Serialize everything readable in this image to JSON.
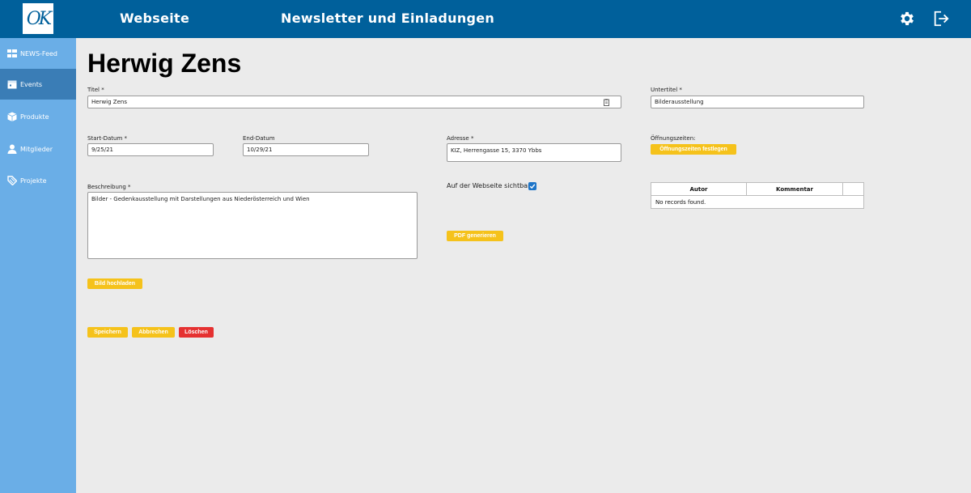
{
  "header": {
    "logo_text": "OK",
    "nav": [
      "Webseite",
      "Newsletter und Einladungen"
    ],
    "settings_icon": "gear-icon",
    "logout_icon": "logout-icon"
  },
  "sidebar": {
    "items": [
      {
        "label": "NEWS-Feed",
        "icon": "grid-icon"
      },
      {
        "label": "Events",
        "icon": "calendar-icon"
      },
      {
        "label": "Produkte",
        "icon": "box-icon"
      },
      {
        "label": "Mitglieder",
        "icon": "user-icon"
      },
      {
        "label": "Projekte",
        "icon": "tag-icon"
      }
    ],
    "active": "Events"
  },
  "page": {
    "title": "Herwig Zens"
  },
  "form": {
    "titel_label": "Titel *",
    "titel_value": "Herwig Zens",
    "untertitel_label": "Untertitel *",
    "untertitel_value": "Bilderausstellung",
    "start_label": "Start-Datum *",
    "start_value": "9/25/21",
    "end_label": "End-Datum",
    "end_value": "10/29/21",
    "adresse_label": "Adresse *",
    "adresse_value": "KIZ, Herrengasse 15, 3370 Ybbs",
    "oeffnung_label": "Öffnungszeiten:",
    "oeffnung_button": "Öffnungszeiten festlegen",
    "beschreibung_label": "Beschreibung *",
    "beschreibung_value": "Bilder - Gedenkausstellung mit Darstellungen aus Niederösterreich und Wien",
    "sichtbar_label": "Auf der Webseite sichtbar:",
    "sichtbar_checked": true,
    "pdf_button": "PDF generieren",
    "upload_button": "Bild hochladen"
  },
  "comments_table": {
    "columns": [
      "Autor",
      "Kommentar",
      ""
    ],
    "empty_message": "No records found."
  },
  "actions": {
    "save": "Speichern",
    "cancel": "Abbrechen",
    "delete": "Löschen"
  },
  "colors": {
    "header": "#00609b",
    "sidebar": "#6aaee7",
    "sidebar_active": "#3a7db6",
    "button_primary": "#f5c21b",
    "button_danger": "#e53131"
  }
}
